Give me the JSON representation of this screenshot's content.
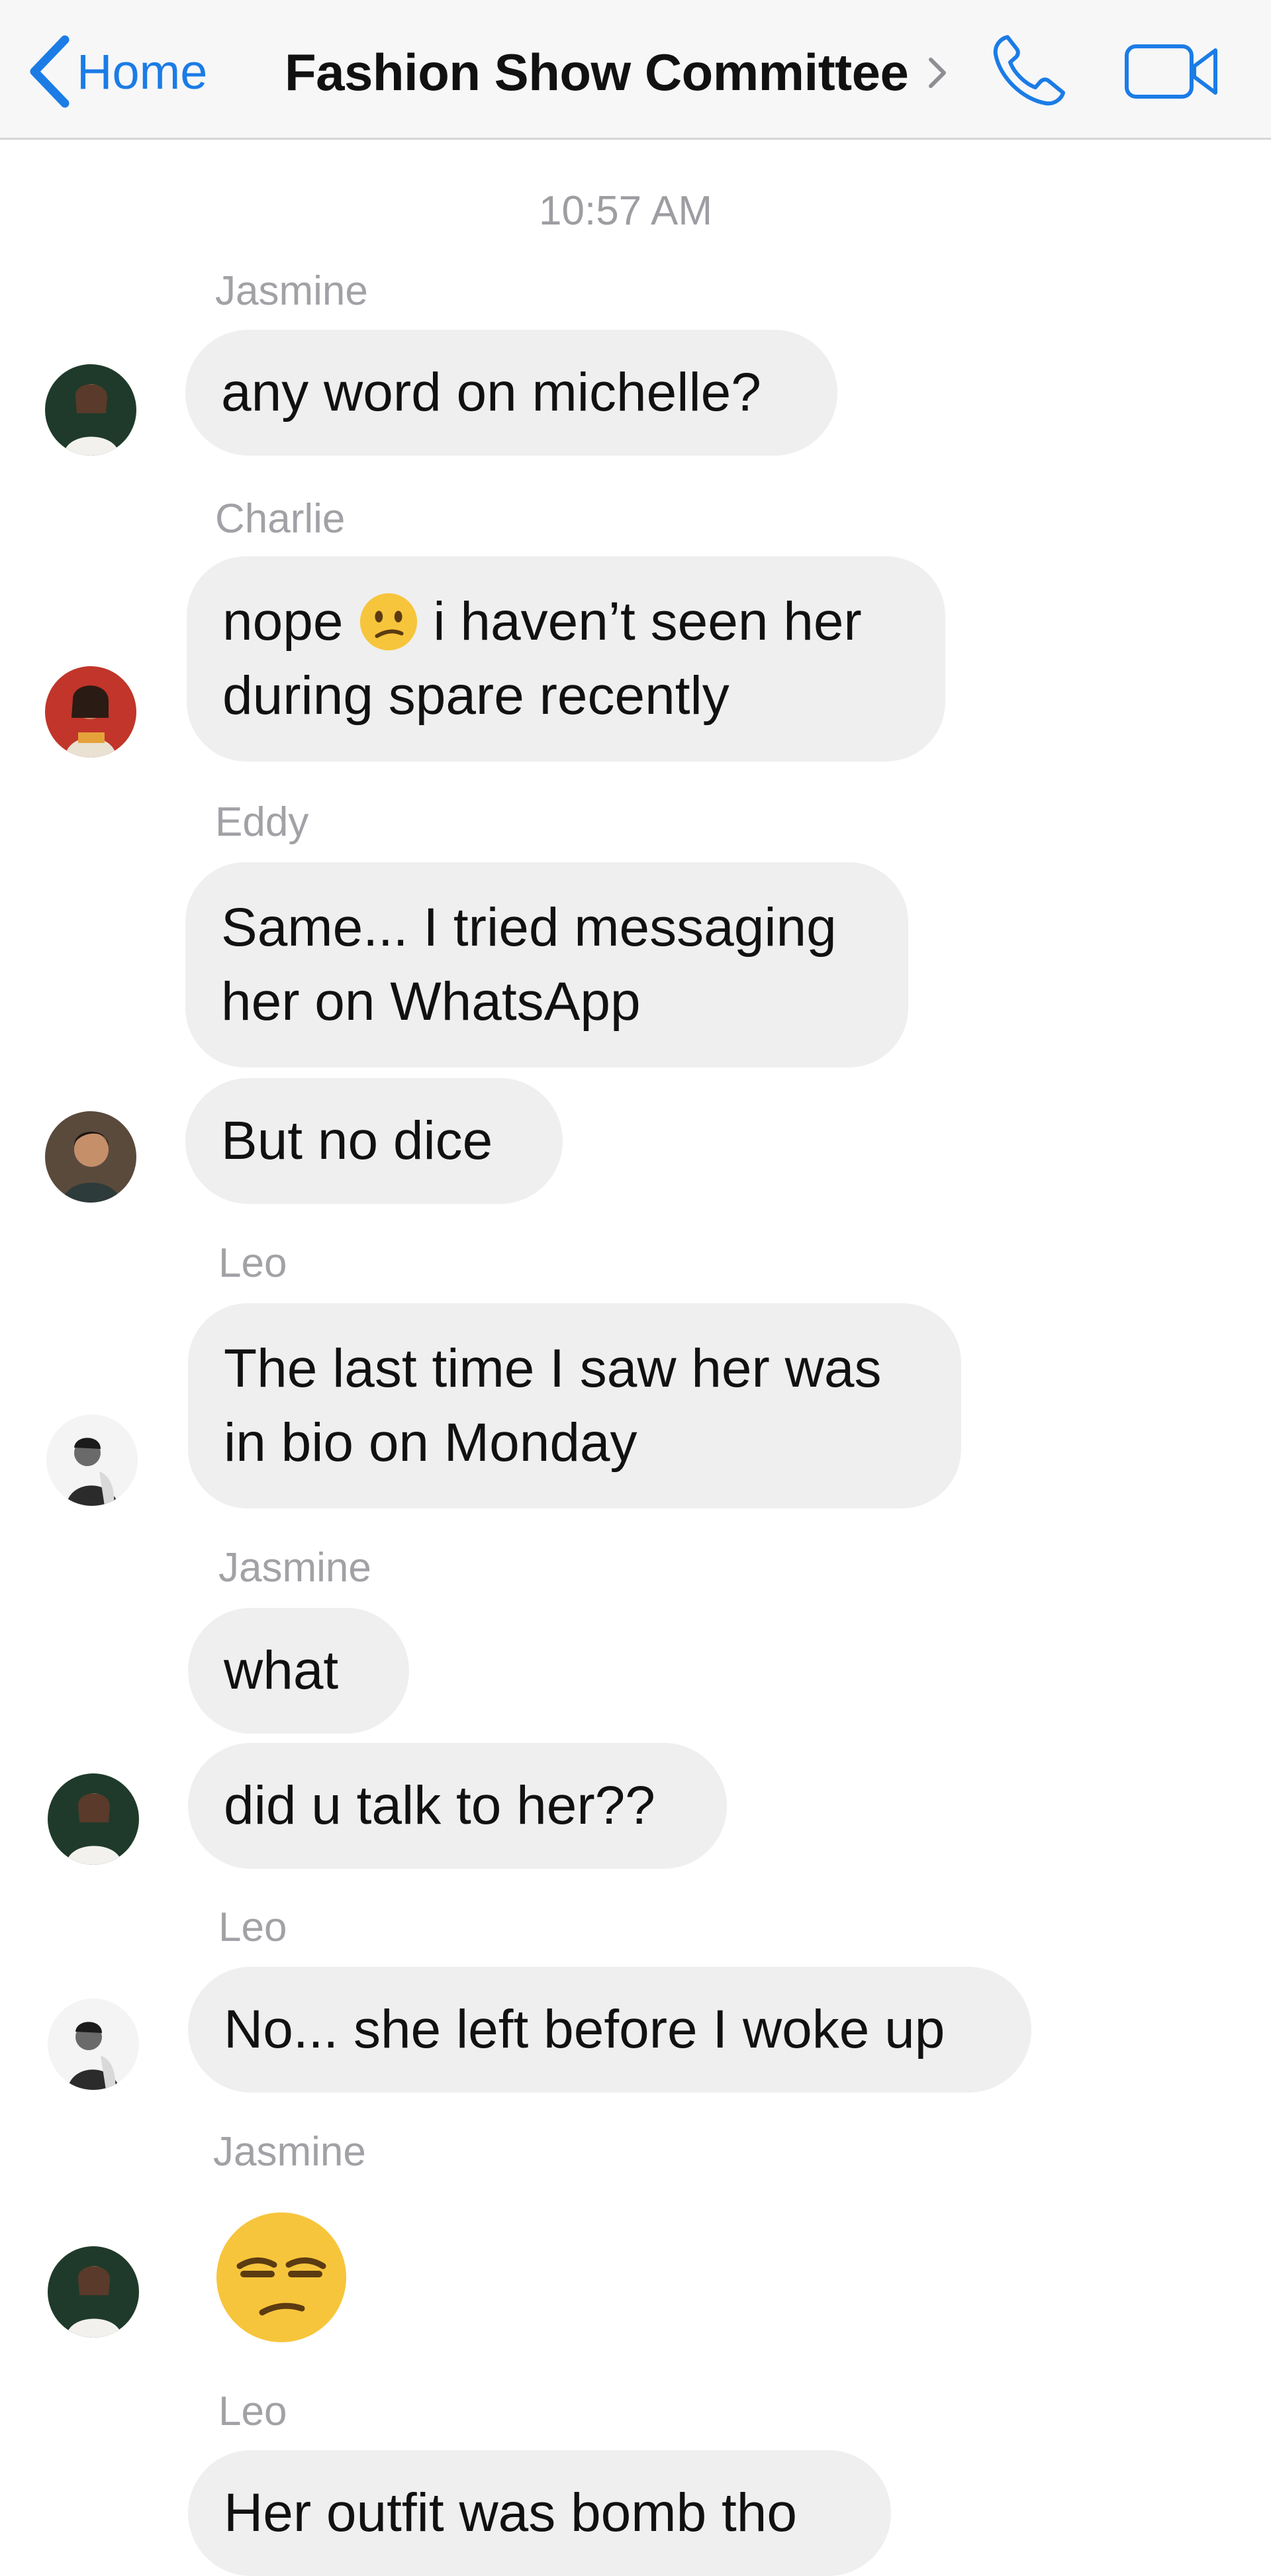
{
  "header": {
    "back_label": "Home",
    "title": "Fashion Show Committee",
    "accent_color": "#1b7ce6"
  },
  "timestamp": "10:57 AM",
  "messages": {
    "jasmine1_sender": "Jasmine",
    "jasmine1_text": "any word on michelle?",
    "charlie_sender": "Charlie",
    "charlie_text_before_emoji": "nope",
    "charlie_emoji": "confused-face",
    "charlie_text_after_emoji": "i haven’t seen her",
    "charlie_text_line2": "during spare recently",
    "eddy_sender": "Eddy",
    "eddy_text1_line1": "Same... I tried messaging",
    "eddy_text1_line2": "her on WhatsApp",
    "eddy_text2": "But no dice",
    "leo1_sender": "Leo",
    "leo1_text_line1": "The last time I saw her was",
    "leo1_text_line2": "in bio on Monday",
    "jasmine2_sender": "Jasmine",
    "jasmine2_text1": "what",
    "jasmine2_text2": "did u talk to her??",
    "leo2_sender": "Leo",
    "leo2_text": "No... she left before I woke up",
    "jasmine3_sender": "Jasmine",
    "jasmine3_emoji": "unamused-face",
    "leo3_sender": "Leo",
    "leo3_text": "Her outfit was bomb tho"
  }
}
